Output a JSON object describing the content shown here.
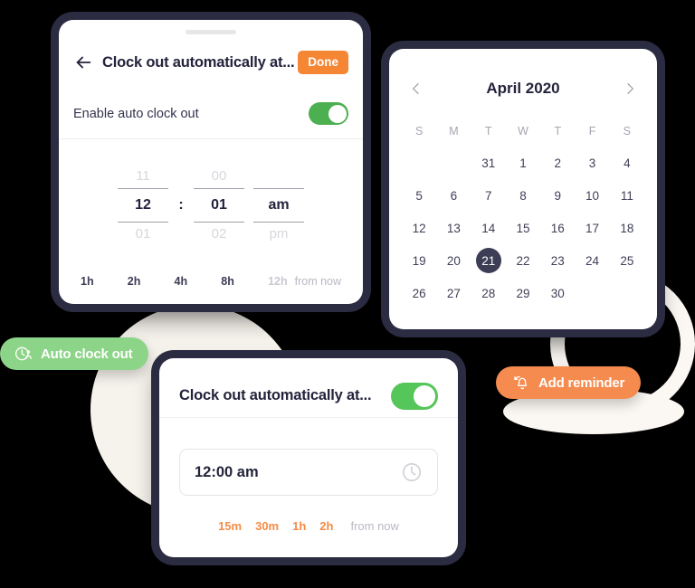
{
  "theme": {
    "accent_orange": "#f58634",
    "accent_green": "#4caf50",
    "badge_green": "#8cd487",
    "badge_orange": "#f58b4f",
    "selected_day": "#3d3d55",
    "card_border": "#2b2b42",
    "deco_circle": "#f6f2ec",
    "deco_ring": "#fbf8f3"
  },
  "picker_sheet": {
    "back_icon": "arrow-left-icon",
    "title": "Clock out automatically at...",
    "done_label": "Done",
    "enable_label": "Enable auto clock out",
    "toggle_state": "on",
    "time_picker": {
      "hour": {
        "prev": "11",
        "current": "12",
        "next": "01"
      },
      "separator": ":",
      "minute": {
        "prev": "00",
        "current": "01",
        "next": "02"
      },
      "meridiem": {
        "prev": "",
        "current": "am",
        "next": "pm"
      }
    },
    "quick_options": [
      {
        "label": "1h",
        "muted": false
      },
      {
        "label": "2h",
        "muted": false
      },
      {
        "label": "4h",
        "muted": false
      },
      {
        "label": "8h",
        "muted": false
      },
      {
        "label": "12h",
        "muted": true
      }
    ],
    "quick_suffix": "from now"
  },
  "calendar": {
    "prev_icon": "chevron-left-icon",
    "next_icon": "chevron-right-icon",
    "title": "April 2020",
    "weekdays": [
      "S",
      "M",
      "T",
      "W",
      "T",
      "F",
      "S"
    ],
    "weeks": [
      [
        null,
        null,
        "31",
        "1",
        "2",
        "3",
        "4"
      ],
      [
        "5",
        "6",
        "7",
        "8",
        "9",
        "10",
        "11"
      ],
      [
        "12",
        "13",
        "14",
        "15",
        "16",
        "17",
        "18"
      ],
      [
        "19",
        "20",
        "21",
        "22",
        "23",
        "24",
        "25"
      ],
      [
        "26",
        "27",
        "28",
        "29",
        "30",
        null,
        null
      ]
    ],
    "selected_day": "21"
  },
  "compact_card": {
    "title": "Clock out automatically at...",
    "toggle_state": "on",
    "time_value": "12:00 am",
    "clock_icon": "clock-icon",
    "quick_options": [
      "15m",
      "30m",
      "1h",
      "2h"
    ],
    "quick_suffix": "from now"
  },
  "badges": {
    "auto_clock_out": {
      "icon": "clock-person-icon",
      "label": "Auto clock out"
    },
    "add_reminder": {
      "icon": "bell-icon",
      "label": "Add reminder"
    }
  }
}
